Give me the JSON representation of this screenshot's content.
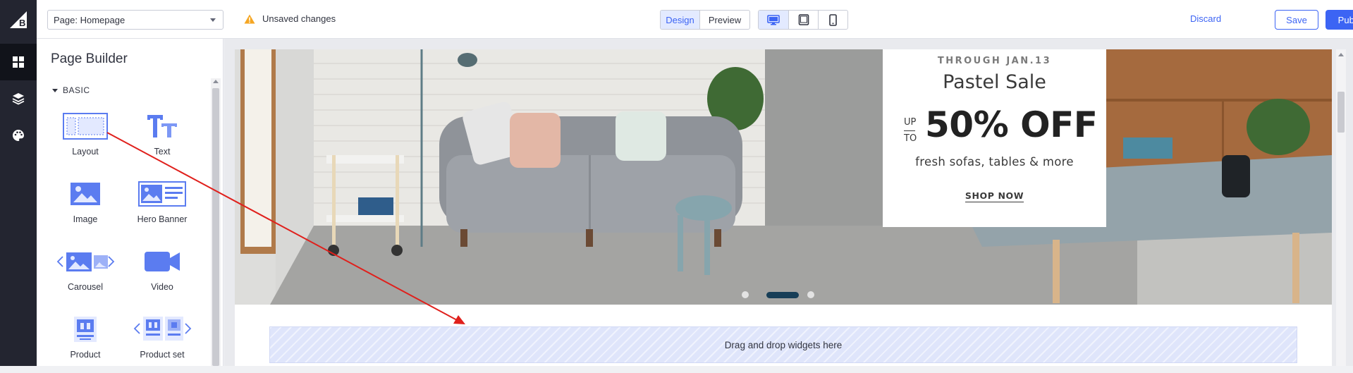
{
  "colors": {
    "accent": "#3c64f4",
    "rail_bg": "#232530",
    "warning": "#f5a623",
    "arrow": "#e0201c",
    "dropzone_bg": "#dfe5fb"
  },
  "topbar": {
    "page_select_value": "Page: Homepage",
    "unsaved_label": "Unsaved changes",
    "mode_design": "Design",
    "mode_preview": "Preview",
    "active_mode": "Design",
    "devices": [
      {
        "icon": "desktop-icon",
        "active": true
      },
      {
        "icon": "tablet-icon",
        "active": false
      },
      {
        "icon": "mobile-icon",
        "active": false
      }
    ],
    "discard_label": "Discard",
    "save_label": "Save",
    "publish_label": "Publish"
  },
  "rail": {
    "items": [
      {
        "icon": "bigcommerce-logo"
      },
      {
        "icon": "widgets-icon",
        "active": true
      },
      {
        "icon": "layers-icon"
      },
      {
        "icon": "palette-icon"
      }
    ]
  },
  "panel": {
    "title": "Page Builder",
    "section": "BASIC",
    "widgets": [
      {
        "label": "Layout",
        "icon": "layout-icon"
      },
      {
        "label": "Text",
        "icon": "text-icon"
      },
      {
        "label": "Image",
        "icon": "image-icon"
      },
      {
        "label": "Hero Banner",
        "icon": "hero-banner-icon"
      },
      {
        "label": "Carousel",
        "icon": "carousel-icon"
      },
      {
        "label": "Video",
        "icon": "video-icon"
      },
      {
        "label": "Product",
        "icon": "product-icon"
      },
      {
        "label": "Product set",
        "icon": "product-set-icon"
      }
    ]
  },
  "hero": {
    "through": "THROUGH JAN.13",
    "title": "Pastel Sale",
    "up": "UP",
    "to": "TO",
    "discount": "50% OFF",
    "subtitle": "fresh sofas, tables & more",
    "cta": "SHOP NOW",
    "slides": 3,
    "active_slide": 2
  },
  "dropzone": {
    "label": "Drag and drop widgets here"
  }
}
